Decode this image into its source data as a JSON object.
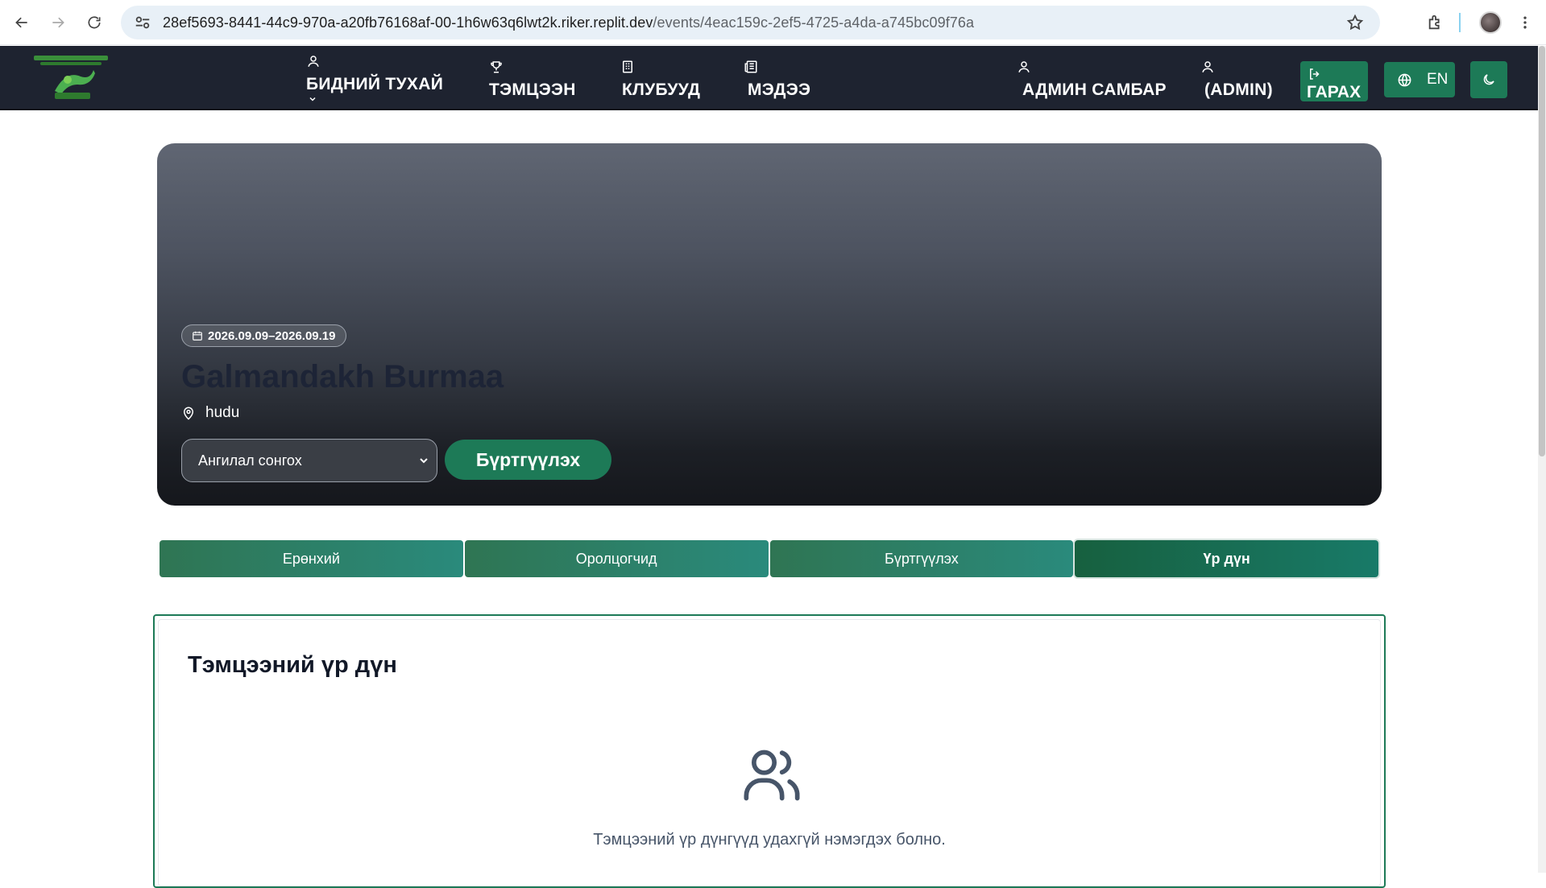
{
  "browser": {
    "url_host": "28ef5693-8441-44c9-970a-a20fb76168af-00-1h6w63q6lwt2k.riker.replit.dev",
    "url_path": "/events/4eac159c-2ef5-4725-a4da-a745bc09f76a"
  },
  "header": {
    "nav": [
      {
        "label": "БИДНИЙ ТУХАЙ",
        "icon": "user-icon"
      },
      {
        "label": "ТЭМЦЭЭН",
        "icon": "trophy-icon"
      },
      {
        "label": "КЛУБУУД",
        "icon": "building-icon"
      },
      {
        "label": "МЭДЭЭ",
        "icon": "newspaper-icon"
      }
    ],
    "admin_label": "АДМИН САМБАР",
    "user_label": "(ADMIN)",
    "logout_label": "ГАРАХ",
    "lang_label": "EN",
    "accent_color": "#1d7a57"
  },
  "hero": {
    "date_range": "2026.09.09–2026.09.19",
    "title": "Galmandakh Burmaa",
    "location": "hudu",
    "category_placeholder": "Ангилал сонгох",
    "register_label": "Бүртгүүлэх"
  },
  "tabs": [
    {
      "label": "Ерөнхий",
      "active": false
    },
    {
      "label": "Оролцогчид",
      "active": false
    },
    {
      "label": "Бүртгүүлэх",
      "active": false
    },
    {
      "label": "Үр дүн",
      "active": true
    }
  ],
  "results": {
    "title": "Тэмцээний үр дүн",
    "empty_message": "Тэмцээний үр дүнгүүд удахгүй нэмэгдэх болно."
  }
}
